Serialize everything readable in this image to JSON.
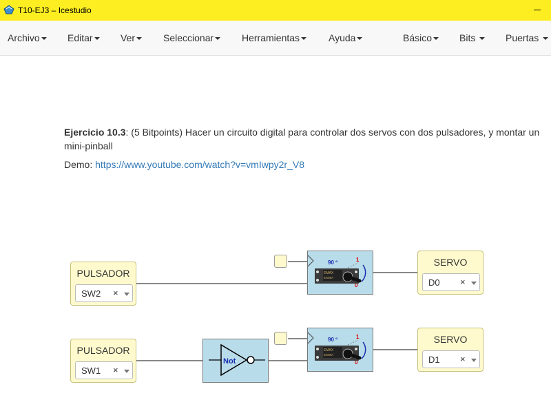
{
  "window": {
    "title": "T10-EJ3 – Icestudio"
  },
  "menu": {
    "archivo": "Archivo",
    "editar": "Editar",
    "ver": "Ver",
    "seleccionar": "Seleccionar",
    "herramientas": "Herramientas",
    "ayuda": "Ayuda",
    "basico": "Básico",
    "bits": "Bits",
    "puertas": "Puertas"
  },
  "exercise": {
    "heading": "Ejercicio 10.3",
    "text": ": (5 Bitpoints) Hacer un circuito digital para controlar dos servos con dos pulsadores, y montar un mini-pinball",
    "demo_label": "Demo: ",
    "demo_link": "https://www.youtube.com/watch?v=vmIwpy2r_V8"
  },
  "blocks": {
    "pulsador_top": {
      "label": "PULSADOR",
      "value": "SW2",
      "clear": "×"
    },
    "pulsador_bottom": {
      "label": "PULSADOR",
      "value": "SW1",
      "clear": "×"
    },
    "servo_top": {
      "label": "SERVO",
      "value": "D0",
      "clear": "×"
    },
    "servo_bottom": {
      "label": "SERVO",
      "value": "D1",
      "clear": "×"
    },
    "not": {
      "label": "Not"
    },
    "servo_icon": {
      "angle": "90 º",
      "one": "1",
      "zero": "0",
      "brand": "EMAX",
      "model": "ES08A"
    }
  },
  "colors": {
    "titlebar": "#fcee21",
    "io_block": "#fffacd",
    "code_block": "#b9dcea",
    "link": "#337ab7"
  }
}
